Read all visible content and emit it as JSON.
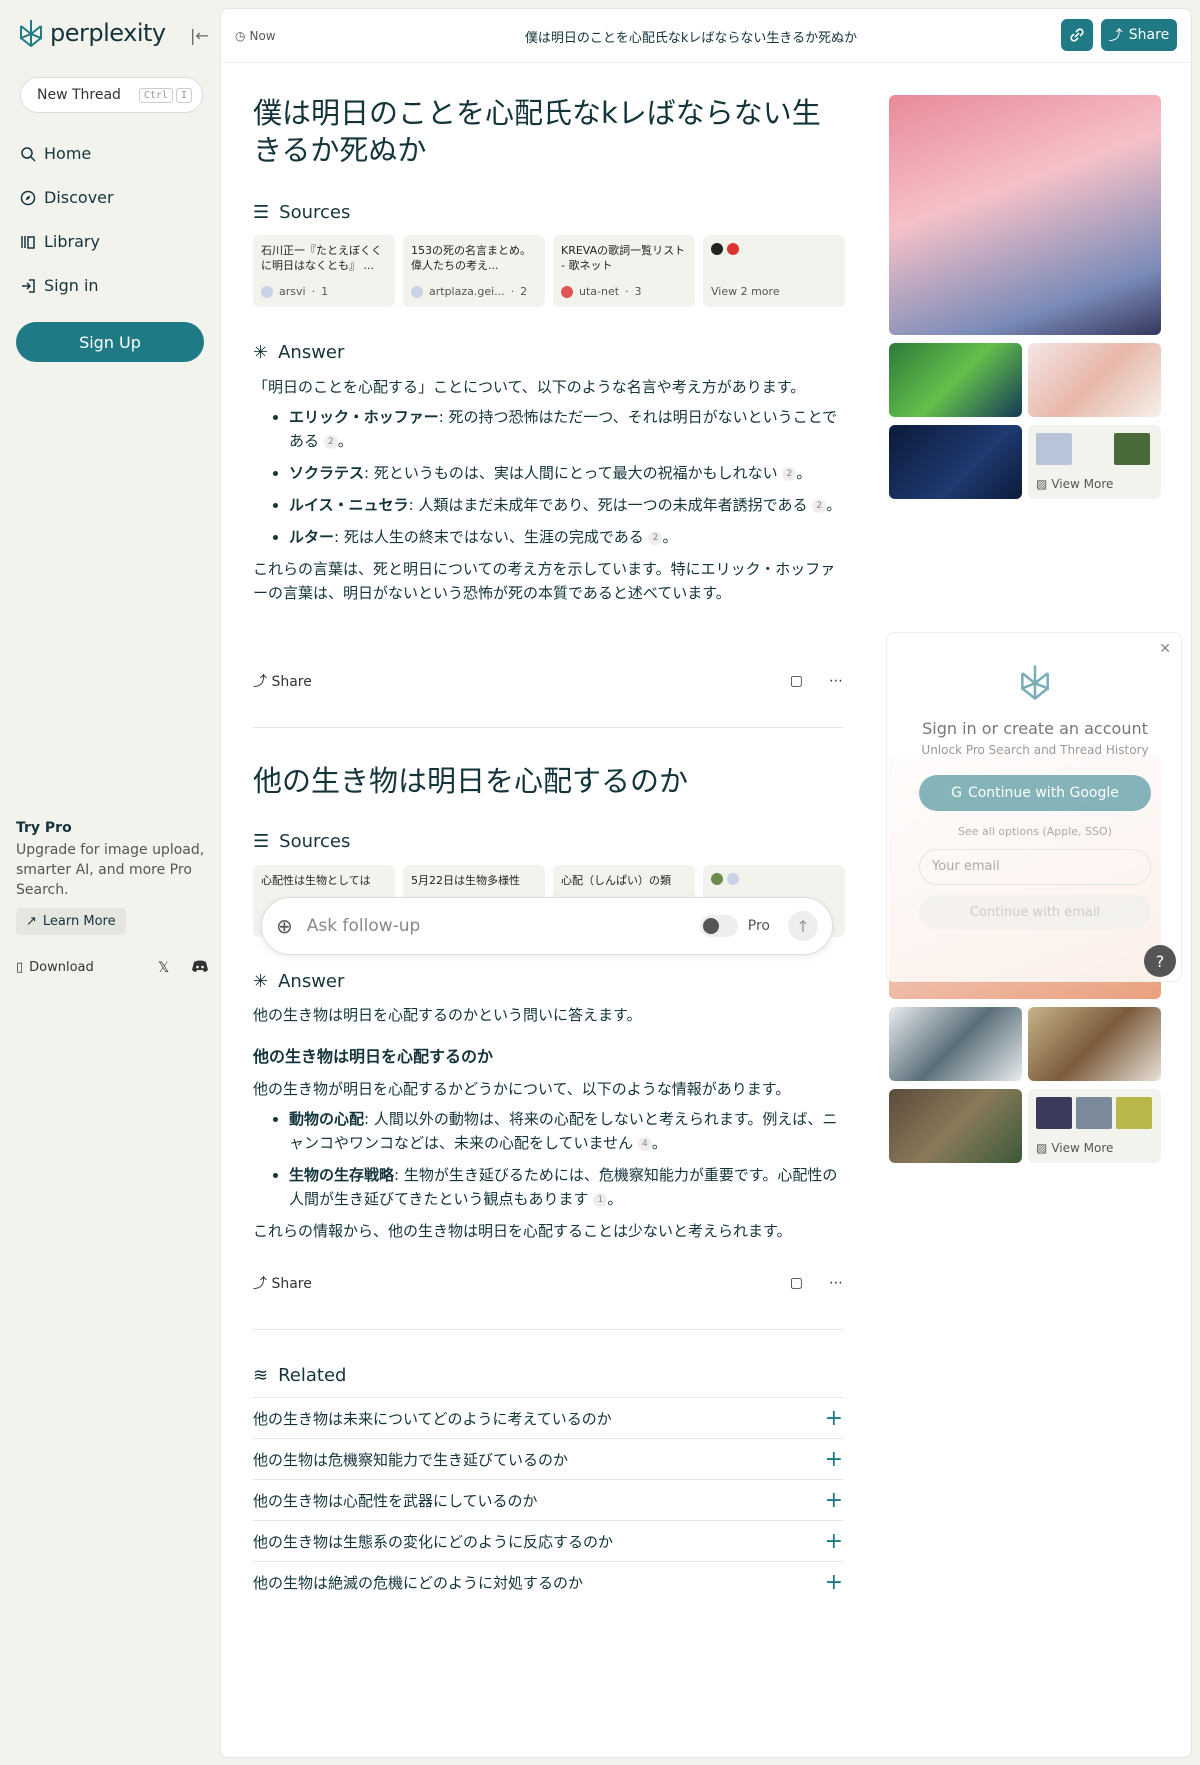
{
  "app": {
    "name": "perplexity"
  },
  "sidebar": {
    "new_thread": "New Thread",
    "shortcut_keys": [
      "Ctrl",
      "I"
    ],
    "nav": [
      {
        "label": "Home",
        "icon": "search-icon"
      },
      {
        "label": "Discover",
        "icon": "compass-icon"
      },
      {
        "label": "Library",
        "icon": "library-icon"
      },
      {
        "label": "Sign in",
        "icon": "sign-in-icon"
      }
    ],
    "signup": "Sign Up",
    "try_pro": {
      "title": "Try Pro",
      "desc": "Upgrade for image upload, smarter AI, and more Pro Search.",
      "learn_more": "Learn More"
    },
    "download": "Download"
  },
  "topbar": {
    "time": "Now",
    "title": "僕は明日のことを心配氏なkレばならない生きるか死ぬか",
    "share": "Share"
  },
  "thread1": {
    "question": "僕は明日のことを心配氏なkレばならない生きるか死ぬか",
    "sources_label": "Sources",
    "sources": [
      {
        "title": "石川正一『たとえぼくくに明日はなくとも』 ...",
        "site": "arsvi",
        "num": "1"
      },
      {
        "title": "153の死の名言まとめ。偉人たちの考え...",
        "site": "artplaza.gei...",
        "num": "2"
      },
      {
        "title": "KREVAの歌詞一覧リスト - 歌ネット",
        "site": "uta-net",
        "num": "3"
      }
    ],
    "view_more": "View 2 more",
    "answer_label": "Answer",
    "intro": "「明日のことを心配する」ことについて、以下のような名言や考え方があります。",
    "bullets": [
      {
        "name": "エリック・ホッファー",
        "text": ": 死の持つ恐怖はただ一つ、それは明日がないということである",
        "cite": "2"
      },
      {
        "name": "ソクラテス",
        "text": ": 死というものは、実は人間にとって最大の祝福かもしれない",
        "cite": "2"
      },
      {
        "name": "ルイス・ニュセラ",
        "text": ": 人類はまだ未成年であり、死は一つの未成年者誘拐である",
        "cite": "2"
      },
      {
        "name": "ルター",
        "text": ": 死は人生の終末ではない、生涯の完成である",
        "cite": "2"
      }
    ],
    "conclusion": "これらの言葉は、死と明日についての考え方を示しています。特にエリック・ホッファーの言葉は、明日がないという恐怖が死の本質であると述べています。",
    "share": "Share",
    "images_view_more": "View More"
  },
  "thread2": {
    "question": "他の生き物は明日を心配するのか",
    "sources_label": "Sources",
    "sources": [
      {
        "title": "心配性は生物としては"
      },
      {
        "title": "5月22日は生物多様性"
      },
      {
        "title": "心配（しんぱい）の類"
      }
    ],
    "answer_label": "Answer",
    "intro": "他の生き物は明日を心配するのかという問いに答えます。",
    "subheading": "他の生き物は明日を心配するのか",
    "sub_intro": "他の生き物が明日を心配するかどうかについて、以下のような情報があります。",
    "bullets": [
      {
        "name": "動物の心配",
        "text": ": 人間以外の動物は、将来の心配をしないと考えられます。例えば、ニャンコやワンコなどは、未来の心配をしていません",
        "cite": "4"
      },
      {
        "name": "生物の生存戦略",
        "text": ": 生物が生き延びるためには、危機察知能力が重要です。心配性の人間が生き延びてきたという観点もあります",
        "cite": "1"
      }
    ],
    "conclusion": "これらの情報から、他の生き物は明日を心配することは少ないと考えられます。",
    "share": "Share",
    "images_view_more": "View More"
  },
  "followup": {
    "placeholder": "Ask follow-up",
    "pro": "Pro"
  },
  "related": {
    "label": "Related",
    "items": [
      "他の生き物は未来についてどのように考えているのか",
      "他の生物は危機察知能力で生き延びているのか",
      "他の生き物は心配性を武器にしているのか",
      "他の生き物は生態系の変化にどのように反応するのか",
      "他の生物は絶滅の危機にどのように対処するのか"
    ]
  },
  "modal": {
    "title": "Sign in or create an account",
    "subtitle": "Unlock Pro Search and Thread History",
    "google": "Continue with Google",
    "all_options": "See all options (Apple, SSO)",
    "email_placeholder": "Your email",
    "continue_email": "Continue with email"
  },
  "help": "?",
  "colors": {
    "accent": "#1f7a86",
    "background": "#f3f3ee",
    "text": "#13343b"
  }
}
